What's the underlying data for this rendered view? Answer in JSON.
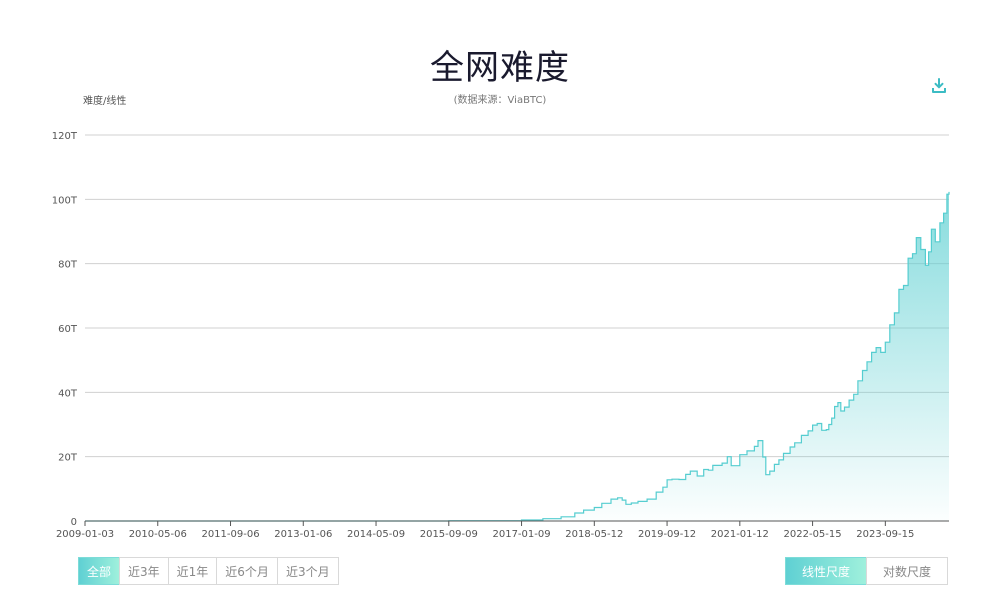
{
  "header": {
    "title": "全网难度",
    "subtitle": "(数据来源：ViaBTC)",
    "y_axis_label": "难度/线性",
    "download_icon": "download-icon"
  },
  "range_buttons": [
    {
      "label": "全部",
      "active": true
    },
    {
      "label": "近3年",
      "active": false
    },
    {
      "label": "近1年",
      "active": false
    },
    {
      "label": "近6个月",
      "active": false
    },
    {
      "label": "近3个月",
      "active": false
    }
  ],
  "scale_buttons": [
    {
      "label": "线性尺度",
      "active": true
    },
    {
      "label": "对数尺度",
      "active": false
    }
  ],
  "colors": {
    "accent": "#4fc9cc",
    "line": "#55cdd0",
    "grid": "#d0d0d0"
  },
  "chart_data": {
    "type": "area",
    "ylim": [
      0,
      120
    ],
    "y_ticks": [
      0,
      20,
      40,
      60,
      80,
      100,
      120
    ],
    "y_tick_labels": [
      "0",
      "20T",
      "40T",
      "60T",
      "80T",
      "100T",
      "120T"
    ],
    "x_range": [
      "2009-01-03",
      "2024-11-15"
    ],
    "x_ticks": [
      "2009-01-03",
      "2010-05-06",
      "2011-09-06",
      "2013-01-06",
      "2014-05-09",
      "2015-09-09",
      "2017-01-09",
      "2018-05-12",
      "2019-09-12",
      "2021-01-12",
      "2022-05-15",
      "2023-09-15"
    ],
    "grid": "horizontal",
    "unit": "T",
    "series": [
      {
        "points": [
          [
            "2009-01-03",
            0
          ],
          [
            "2013-01-06",
            0
          ],
          [
            "2015-09-09",
            0.1
          ],
          [
            "2017-01-09",
            0.3
          ],
          [
            "2017-06-01",
            0.7
          ],
          [
            "2017-10-01",
            1.3
          ],
          [
            "2018-01-01",
            2.5
          ],
          [
            "2018-03-01",
            3.4
          ],
          [
            "2018-05-12",
            4.2
          ],
          [
            "2018-07-01",
            5.5
          ],
          [
            "2018-09-01",
            6.8
          ],
          [
            "2018-10-15",
            7.2
          ],
          [
            "2018-11-15",
            6.5
          ],
          [
            "2018-12-10",
            5.2
          ],
          [
            "2019-01-15",
            5.6
          ],
          [
            "2019-03-01",
            6.1
          ],
          [
            "2019-05-01",
            6.8
          ],
          [
            "2019-07-01",
            9.0
          ],
          [
            "2019-08-15",
            10.5
          ],
          [
            "2019-09-12",
            12.8
          ],
          [
            "2019-10-15",
            13.0
          ],
          [
            "2019-12-01",
            12.9
          ],
          [
            "2020-01-15",
            14.5
          ],
          [
            "2020-02-15",
            15.5
          ],
          [
            "2020-04-01",
            14.0
          ],
          [
            "2020-05-15",
            16.0
          ],
          [
            "2020-06-15",
            15.8
          ],
          [
            "2020-07-15",
            17.3
          ],
          [
            "2020-09-15",
            18.0
          ],
          [
            "2020-10-20",
            20.0
          ],
          [
            "2020-11-15",
            17.2
          ],
          [
            "2021-01-12",
            20.6
          ],
          [
            "2021-03-01",
            21.8
          ],
          [
            "2021-04-20",
            23.2
          ],
          [
            "2021-05-14",
            25.0
          ],
          [
            "2021-06-15",
            19.9
          ],
          [
            "2021-07-05",
            14.4
          ],
          [
            "2021-08-01",
            15.5
          ],
          [
            "2021-09-01",
            17.6
          ],
          [
            "2021-10-01",
            19.0
          ],
          [
            "2021-11-01",
            21.0
          ],
          [
            "2021-12-15",
            23.0
          ],
          [
            "2022-01-15",
            24.3
          ],
          [
            "2022-03-01",
            26.6
          ],
          [
            "2022-04-15",
            28.0
          ],
          [
            "2022-05-15",
            29.8
          ],
          [
            "2022-06-15",
            30.3
          ],
          [
            "2022-07-15",
            28.2
          ],
          [
            "2022-08-15",
            28.4
          ],
          [
            "2022-09-01",
            30.0
          ],
          [
            "2022-09-20",
            32.0
          ],
          [
            "2022-10-10",
            35.6
          ],
          [
            "2022-11-01",
            36.8
          ],
          [
            "2022-11-20",
            34.2
          ],
          [
            "2022-12-15",
            35.4
          ],
          [
            "2023-01-15",
            37.6
          ],
          [
            "2023-02-15",
            39.4
          ],
          [
            "2023-03-15",
            43.6
          ],
          [
            "2023-04-15",
            46.8
          ],
          [
            "2023-05-15",
            49.5
          ],
          [
            "2023-06-15",
            52.4
          ],
          [
            "2023-07-15",
            53.9
          ],
          [
            "2023-08-15",
            52.4
          ],
          [
            "2023-09-15",
            55.6
          ],
          [
            "2023-10-15",
            61.0
          ],
          [
            "2023-11-15",
            64.7
          ],
          [
            "2023-12-15",
            72.0
          ],
          [
            "2024-01-15",
            73.2
          ],
          [
            "2024-02-15",
            81.7
          ],
          [
            "2024-03-15",
            83.1
          ],
          [
            "2024-04-10",
            88.1
          ],
          [
            "2024-05-10",
            84.4
          ],
          [
            "2024-06-10",
            79.5
          ],
          [
            "2024-07-01",
            83.7
          ],
          [
            "2024-07-20",
            90.7
          ],
          [
            "2024-08-15",
            86.8
          ],
          [
            "2024-09-15",
            92.7
          ],
          [
            "2024-10-10",
            95.7
          ],
          [
            "2024-11-01",
            101.6
          ],
          [
            "2024-11-15",
            102.3
          ]
        ]
      }
    ]
  }
}
